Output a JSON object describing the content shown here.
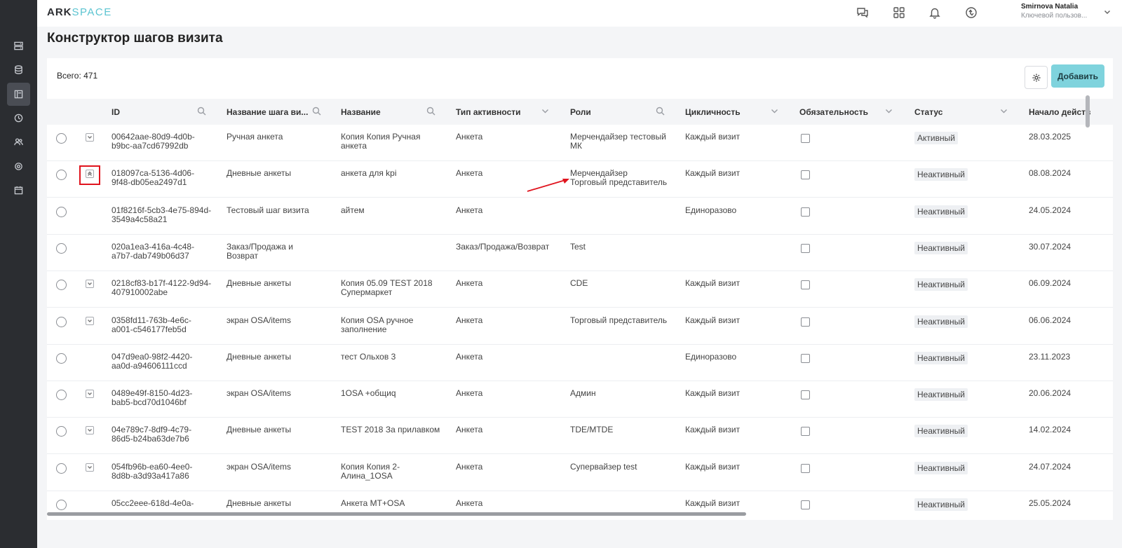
{
  "app": {
    "logo_part1": "ARK",
    "logo_part2": "SPACE"
  },
  "sidebar": {
    "items": [
      {
        "icon": "server-icon"
      },
      {
        "icon": "database-icon"
      },
      {
        "icon": "layout-icon",
        "active": true
      },
      {
        "icon": "clock-icon"
      },
      {
        "icon": "users-icon"
      },
      {
        "icon": "gear-icon"
      },
      {
        "icon": "calendar-icon"
      }
    ]
  },
  "header": {
    "icons": [
      "chat-icon",
      "apps-grid-icon",
      "bell-icon",
      "sync-icon"
    ],
    "user_name": "Smirnova Natalia",
    "user_role": "Ключевой пользов..."
  },
  "page": {
    "title": "Конструктор шагов визита"
  },
  "toolbar": {
    "total": "Всего: 471",
    "add_label": "Добавить"
  },
  "table": {
    "columns": [
      "ID",
      "Название шага ви...",
      "Название",
      "Тип активности",
      "Роли",
      "Цикличность",
      "Обязательность",
      "Статус",
      "Начало действ"
    ],
    "rows": [
      {
        "id1": "00642aae-80d9-4d0b-",
        "id2": "b9bc-aa7cd67992db",
        "step": "Ручная анкета",
        "step2": "",
        "name1": "Копия Копия Ручная",
        "name2": "анкета",
        "type": "Анкета",
        "roles1": "Мерчендайзер тестовый",
        "roles2": "МК",
        "cycle": "Каждый визит",
        "status": "Активный",
        "start": "28.03.2025",
        "expand": "down"
      },
      {
        "id1": "018097ca-5136-4d06-",
        "id2": "9f48-db05ea2497d1",
        "step": "Дневные анкеты",
        "step2": "",
        "name1": "анкета для kpi",
        "name2": "",
        "type": "Анкета",
        "roles1": "Мерчендайзер",
        "roles2": "Торговый представитель",
        "cycle": "Каждый визит",
        "status": "Неактивный",
        "start": "08.08.2024",
        "expand": "up"
      },
      {
        "id1": "01f8216f-5cb3-4e75-894d-",
        "id2": "3549a4c58a21",
        "step": "Тестовый шаг визита",
        "step2": "",
        "name1": "айтем",
        "name2": "",
        "type": "Анкета",
        "roles1": "",
        "roles2": "",
        "cycle": "Единоразово",
        "status": "Неактивный",
        "start": "24.05.2024",
        "expand": ""
      },
      {
        "id1": "020a1ea3-416a-4c48-",
        "id2": "a7b7-dab749b06d37",
        "step": "Заказ/Продажа и",
        "step2": "Возврат",
        "name1": "",
        "name2": "",
        "type": "Заказ/Продажа/Возврат",
        "roles1": "Test",
        "roles2": "",
        "cycle": "",
        "status": "Неактивный",
        "start": "30.07.2024",
        "expand": ""
      },
      {
        "id1": "0218cf83-b17f-4122-9d94-",
        "id2": "407910002abe",
        "step": "Дневные анкеты",
        "step2": "",
        "name1": "Копия 05.09 TEST 2018",
        "name2": "Супермаркет",
        "type": "Анкета",
        "roles1": "CDE",
        "roles2": "",
        "cycle": "Каждый визит",
        "status": "Неактивный",
        "start": "06.09.2024",
        "expand": "down"
      },
      {
        "id1": "0358fd11-763b-4e6c-",
        "id2": "a001-c546177feb5d",
        "step": "экран OSA/items",
        "step2": "",
        "name1": "Копия OSA ручное",
        "name2": "заполнение",
        "type": "Анкета",
        "roles1": "Торговый представитель",
        "roles2": "",
        "cycle": "Каждый визит",
        "status": "Неактивный",
        "start": "06.06.2024",
        "expand": "down"
      },
      {
        "id1": "047d9ea0-98f2-4420-",
        "id2": "aa0d-a94606111ccd",
        "step": "Дневные анкеты",
        "step2": "",
        "name1": "тест Ольхов 3",
        "name2": "",
        "type": "Анкета",
        "roles1": "",
        "roles2": "",
        "cycle": "Единоразово",
        "status": "Неактивный",
        "start": "23.11.2023",
        "expand": ""
      },
      {
        "id1": "0489e49f-8150-4d23-",
        "id2": "bab5-bcd70d1046bf",
        "step": "экран OSA/items",
        "step2": "",
        "name1": "1OSA +общиq",
        "name2": "",
        "type": "Анкета",
        "roles1": "Админ",
        "roles2": "",
        "cycle": "Каждый визит",
        "status": "Неактивный",
        "start": "20.06.2024",
        "expand": "down"
      },
      {
        "id1": "04e789c7-8df9-4c79-",
        "id2": "86d5-b24ba63de7b6",
        "step": "Дневные анкеты",
        "step2": "",
        "name1": "TEST 2018 За прилавком",
        "name2": "",
        "type": "Анкета",
        "roles1": "TDE/MTDE",
        "roles2": "",
        "cycle": "Каждый визит",
        "status": "Неактивный",
        "start": "14.02.2024",
        "expand": "down"
      },
      {
        "id1": "054fb96b-ea60-4ee0-",
        "id2": "8d8b-a3d93a417a86",
        "step": "экран OSA/items",
        "step2": "",
        "name1": "Копия Копия 2-",
        "name2": "Алина_1OSA",
        "type": "Анкета",
        "roles1": "Супервайзер test",
        "roles2": "",
        "cycle": "Каждый визит",
        "status": "Неактивный",
        "start": "24.07.2024",
        "expand": "down"
      },
      {
        "id1": "05cc2eee-618d-4e0a-",
        "id2": "",
        "step": "Дневные анкеты",
        "step2": "",
        "name1": "Анкета МТ+OSA",
        "name2": "",
        "type": "Анкета",
        "roles1": "",
        "roles2": "",
        "cycle": "Каждый визит",
        "status": "Неактивный",
        "start": "25.05.2024",
        "expand": ""
      }
    ]
  },
  "colors": {
    "accent": "#7fd3dd",
    "sidebar": "#2b2d31",
    "highlight": "#e0141e"
  }
}
